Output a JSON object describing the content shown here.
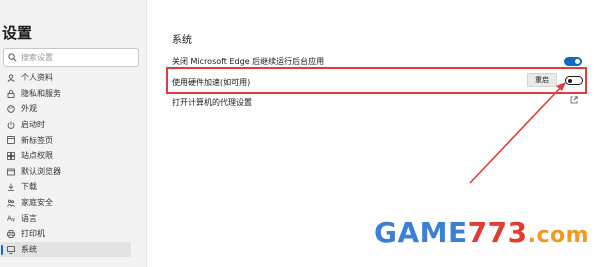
{
  "sidebar": {
    "title": "设置",
    "search": {
      "placeholder": "搜索设置"
    },
    "items": [
      {
        "label": "个人资料",
        "icon": "profile-icon"
      },
      {
        "label": "隐私和服务",
        "icon": "lock-icon"
      },
      {
        "label": "外观",
        "icon": "appearance-icon"
      },
      {
        "label": "启动时",
        "icon": "power-icon"
      },
      {
        "label": "新标签页",
        "icon": "new-tab-icon"
      },
      {
        "label": "站点权限",
        "icon": "site-permissions-icon"
      },
      {
        "label": "默认浏览器",
        "icon": "browser-icon"
      },
      {
        "label": "下载",
        "icon": "download-icon"
      },
      {
        "label": "家庭安全",
        "icon": "family-icon"
      },
      {
        "label": "语言",
        "icon": "language-icon"
      },
      {
        "label": "打印机",
        "icon": "printer-icon"
      },
      {
        "label": "系统",
        "icon": "system-icon",
        "active": true
      }
    ]
  },
  "main": {
    "section_title": "系统",
    "settings": [
      {
        "label": "关闭 Microsoft Edge 后继续运行后台应用",
        "toggle": "on"
      },
      {
        "label": "使用硬件加速(如可用)",
        "button": "重启",
        "toggle": "off"
      },
      {
        "label": "打开计算机的代理设置",
        "icon": "external-link-icon"
      }
    ]
  },
  "watermark": {
    "part1": "GAME",
    "part2": "773",
    "part3": ".com"
  },
  "colors": {
    "accent": "#0f6cbd",
    "highlight": "#e23b3b"
  }
}
